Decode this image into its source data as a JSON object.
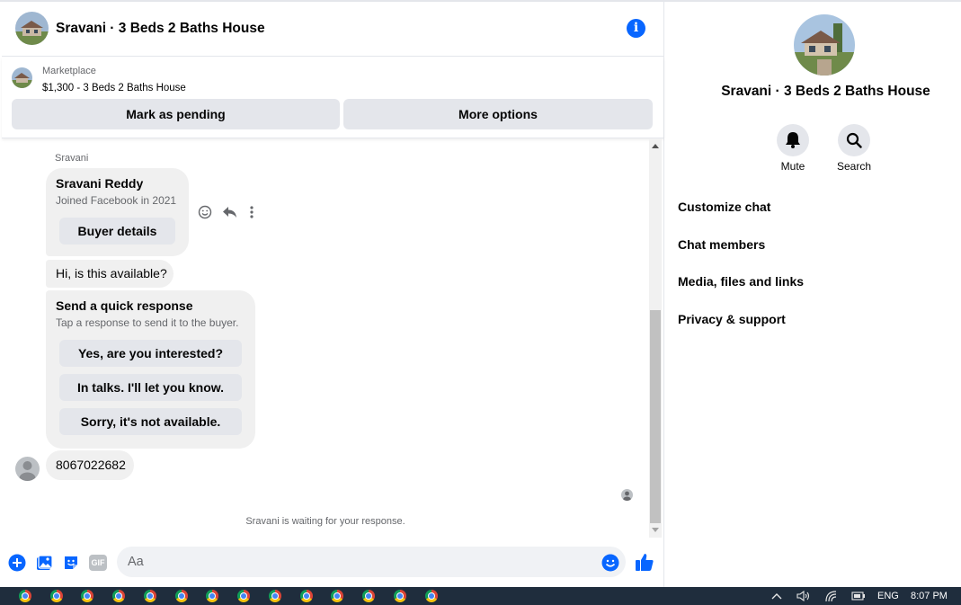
{
  "header": {
    "title": "Sravani · 3 Beds 2 Baths House",
    "info_icon": "i"
  },
  "listing": {
    "category": "Marketplace",
    "title": "$1,300 - 3 Beds 2 Baths House",
    "mark_pending_label": "Mark as pending",
    "more_options_label": "More options"
  },
  "messages": {
    "sender_name": "Sravani",
    "buyer_card": {
      "name": "Sravani Reddy",
      "joined": "Joined Facebook in 2021",
      "button_label": "Buyer details"
    },
    "first_message": "Hi, is this available?",
    "quick_response": {
      "title": "Send a quick response",
      "subtitle": "Tap a response to send it to the buyer.",
      "options": [
        "Yes, are you interested?",
        "In talks. I'll let you know.",
        "Sorry, it's not available."
      ]
    },
    "my_message": "8067022682",
    "waiting_text": "Sravani is waiting for your response."
  },
  "composer": {
    "placeholder": "Aa",
    "gif_label": "GIF"
  },
  "side_panel": {
    "title": "Sravani · 3 Beds 2 Baths House",
    "mute_label": "Mute",
    "search_label": "Search",
    "menu_items": [
      "Customize chat",
      "Chat members",
      "Media, files and links",
      "Privacy & support"
    ]
  },
  "taskbar": {
    "language": "ENG",
    "time": "8:07 PM"
  },
  "colors": {
    "accent": "#0866ff",
    "bubble": "#f0f0f0",
    "button": "#e4e6eb",
    "taskbar": "#1f2d3d"
  }
}
